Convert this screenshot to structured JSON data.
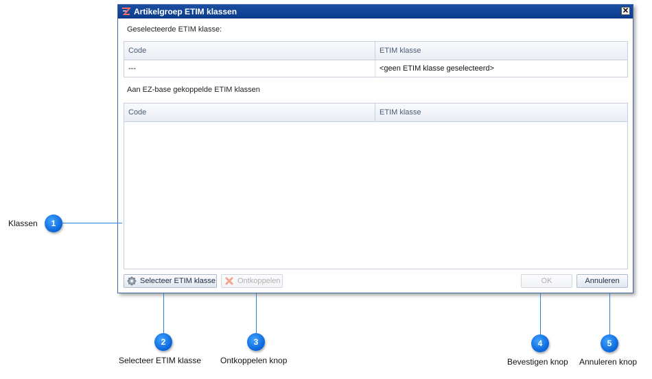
{
  "dialog": {
    "title": "Artikelgroep ETIM klassen",
    "close_glyph": "✕",
    "selected_label": "Geselecteerde ETIM klasse:",
    "selected_grid": {
      "columns": [
        "Code",
        "ETIM klasse"
      ],
      "rows": [
        [
          "---",
          "<geen ETIM klasse geselecteerd>"
        ]
      ]
    },
    "linked_label": "Aan EZ-base gekoppelde ETIM klassen",
    "linked_grid": {
      "columns": [
        "Code",
        "ETIM klasse"
      ],
      "rows": []
    },
    "buttons": {
      "select": "Selecteer ETIM klasse",
      "unlink": "Ontkoppelen",
      "ok": "OK",
      "cancel": "Annuleren"
    }
  },
  "callouts": [
    {
      "number": "1",
      "label": "Klassen"
    },
    {
      "number": "2",
      "label": "Selecteer ETIM klasse"
    },
    {
      "number": "3",
      "label": "Ontkoppelen knop"
    },
    {
      "number": "4",
      "label": "Bevestigen knop"
    },
    {
      "number": "5",
      "label": "Annuleren knop"
    }
  ],
  "icons": {
    "app": "etim-app-icon",
    "select": "gear-icon",
    "unlink": "unlink-x-icon"
  },
  "colors": {
    "titlebar": "#0c3b8c",
    "callout": "#0a64d9",
    "connector": "#2d7fd8"
  }
}
